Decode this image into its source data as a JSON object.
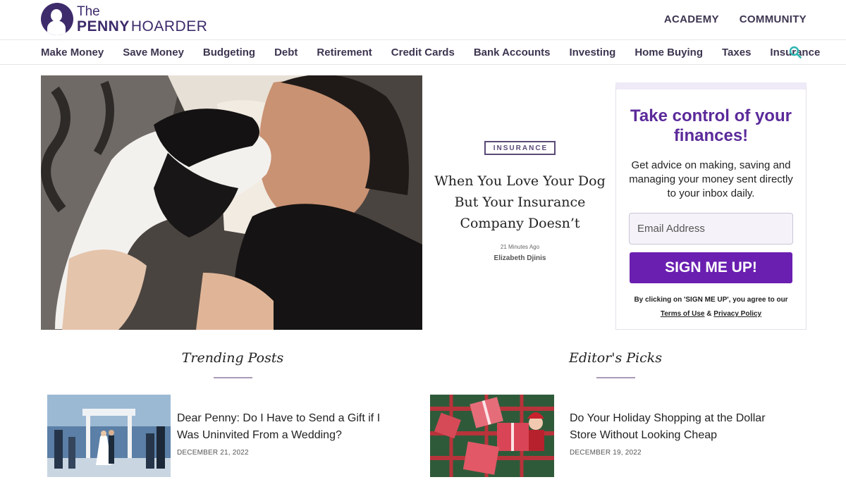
{
  "header": {
    "logo": {
      "the": "The",
      "penny": "PENNY",
      "hoarder": "HOARDER"
    },
    "top_links": [
      "ACADEMY",
      "COMMUNITY"
    ]
  },
  "nav": {
    "items": [
      "Make Money",
      "Save Money",
      "Budgeting",
      "Debt",
      "Retirement",
      "Credit Cards",
      "Bank Accounts",
      "Investing",
      "Home Buying",
      "Taxes",
      "Insurance"
    ],
    "search_icon": "search-icon"
  },
  "hero": {
    "category": "INSURANCE",
    "title": "When You Love Your Dog But Your Insurance Company Doesn’t",
    "time": "21 Minutes Ago",
    "author": "Elizabeth Djinis"
  },
  "signup": {
    "title": "Take control of your finances!",
    "description": "Get advice on making, saving and managing your money sent directly to your inbox daily.",
    "email_placeholder": "Email Address",
    "button": "SIGN ME UP!",
    "legal_prefix": "By clicking on 'SIGN ME UP', you agree to our",
    "terms": "Terms of Use",
    "and": "&",
    "privacy": "Privacy Policy"
  },
  "trending": {
    "heading": "Trending Posts",
    "post": {
      "title": "Dear Penny: Do I Have to Send a Gift if I Was Uninvited From a Wedding?",
      "date": "DECEMBER 21, 2022"
    }
  },
  "editors": {
    "heading": "Editor's Picks",
    "post": {
      "title": "Do Your Holiday Shopping at the Dollar Store Without Looking Cheap",
      "date": "DECEMBER 19, 2022"
    }
  },
  "colors": {
    "brand": "#3d2b6b",
    "accent": "#6a1fb0",
    "search": "#2fb5b0"
  }
}
